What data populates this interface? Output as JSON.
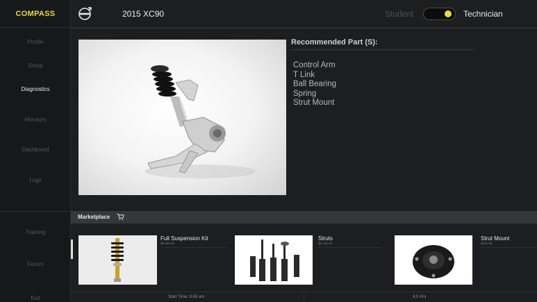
{
  "app": {
    "name": "COMPASS"
  },
  "sidebar": {
    "items": [
      {
        "label": "Profile"
      },
      {
        "label": "Setup"
      },
      {
        "label": "Diagnostics",
        "active": true
      },
      {
        "label": "Monitors"
      },
      {
        "label": "Dashboard"
      },
      {
        "label": "Logs"
      }
    ],
    "lower_items": [
      {
        "label": "Training"
      },
      {
        "label": "Forum"
      },
      {
        "label": "Exit"
      }
    ]
  },
  "header": {
    "brand_icon": "volvo-logo-icon",
    "vehicle": "2015 XC90",
    "mode_left": "Student",
    "mode_right": "Technician",
    "mode_selected": "Technician",
    "accent_color": "#e5d94c"
  },
  "recommended": {
    "heading": "Recommended Part (S):",
    "parts": [
      "Control Arm",
      "T Link",
      "Ball Bearing",
      "Spring",
      "Strut Mount"
    ]
  },
  "marketplace": {
    "label": "Marketplace",
    "icon": "cart-icon",
    "items": [
      {
        "name": "Full Suspension Kit",
        "price": "$5,500.56"
      },
      {
        "name": "Struts",
        "price": "$1,245.78"
      },
      {
        "name": "Strut Mount",
        "price": "$106.99"
      }
    ]
  },
  "footer": {
    "start_time": "Start Time: 9:45 am",
    "duration": "4.5 Hrs"
  }
}
